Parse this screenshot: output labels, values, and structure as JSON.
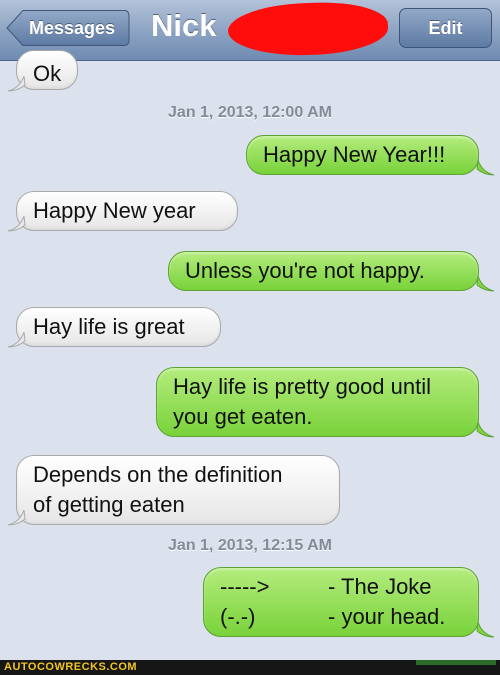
{
  "navbar": {
    "back_label": "Messages",
    "title": "Nick",
    "edit_label": "Edit"
  },
  "messages": [
    {
      "side": "in",
      "text": "Ok"
    },
    {
      "timestamp": "Jan 1, 2013, 12:00 AM"
    },
    {
      "side": "out",
      "text": "Happy New Year!!!"
    },
    {
      "side": "in",
      "text": "Happy New year"
    },
    {
      "side": "out",
      "text": "Unless you're not happy."
    },
    {
      "side": "in",
      "text": "Hay life is great"
    },
    {
      "side": "out",
      "lines": [
        "Hay life is pretty good until",
        "you get eaten."
      ]
    },
    {
      "side": "in",
      "lines": [
        "Depends on the definition",
        "of getting eaten"
      ]
    },
    {
      "timestamp": "Jan 1, 2013, 12:15 AM"
    },
    {
      "side": "out",
      "rows": [
        [
          "----->",
          "- The Joke"
        ],
        [
          "(-.-)",
          "- your head."
        ]
      ]
    }
  ],
  "footer": {
    "watermark": "AUTOCOWRECKS.COM"
  },
  "colors": {
    "incoming_bubble": "#f2f2f2",
    "outgoing_bubble": "#8fdc52",
    "navbar": "#8ea5c4",
    "background": "#dbe2ed",
    "redaction": "#ff0c0c"
  }
}
